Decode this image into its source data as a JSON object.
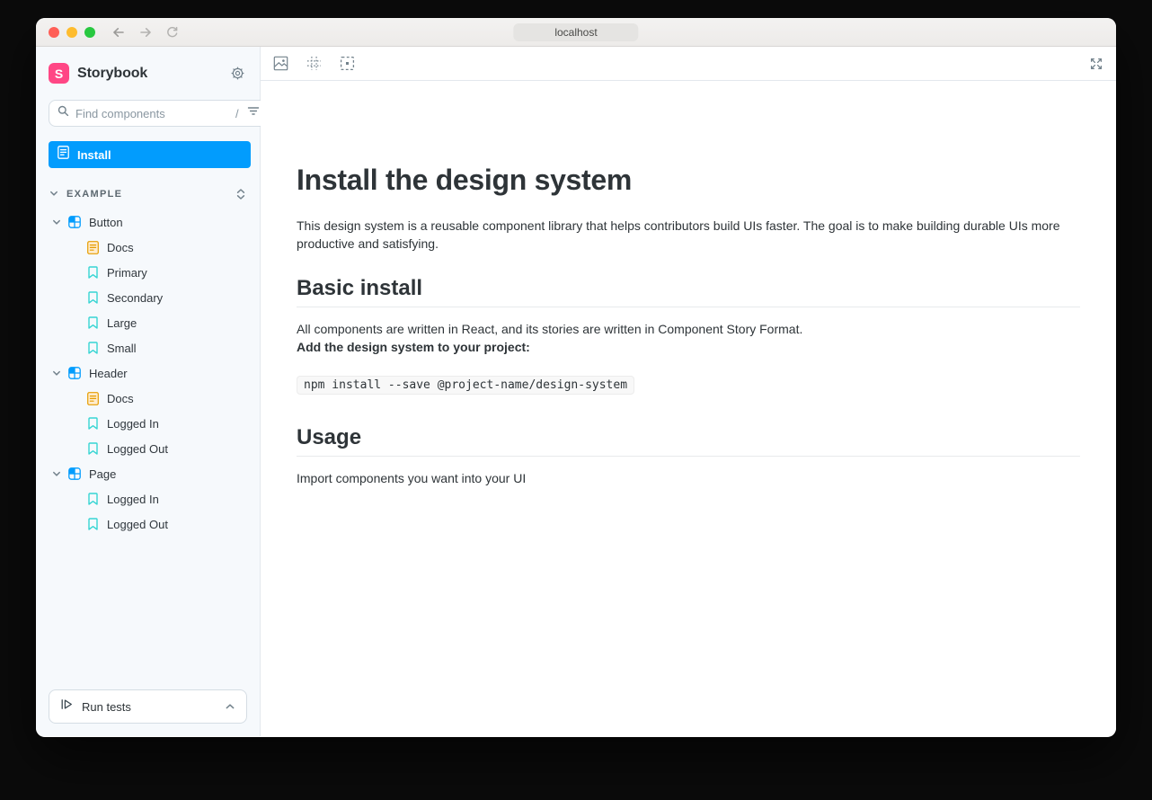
{
  "titlebar": {
    "url": "localhost"
  },
  "sidebar": {
    "brand": "Storybook",
    "logo_letter": "S",
    "search": {
      "placeholder": "Find components",
      "shortcut": "/"
    },
    "selected_doc": {
      "label": "Install"
    },
    "section_label": "EXAMPLE",
    "tree": [
      {
        "label": "Button",
        "type": "component",
        "expanded": true,
        "children": [
          {
            "label": "Docs",
            "type": "docs"
          },
          {
            "label": "Primary",
            "type": "story"
          },
          {
            "label": "Secondary",
            "type": "story"
          },
          {
            "label": "Large",
            "type": "story"
          },
          {
            "label": "Small",
            "type": "story"
          }
        ]
      },
      {
        "label": "Header",
        "type": "component",
        "expanded": true,
        "children": [
          {
            "label": "Docs",
            "type": "docs"
          },
          {
            "label": "Logged In",
            "type": "story"
          },
          {
            "label": "Logged Out",
            "type": "story"
          }
        ]
      },
      {
        "label": "Page",
        "type": "component",
        "expanded": true,
        "children": [
          {
            "label": "Logged In",
            "type": "story"
          },
          {
            "label": "Logged Out",
            "type": "story"
          }
        ]
      }
    ],
    "run_tests_label": "Run tests"
  },
  "content": {
    "title": "Install the design system",
    "intro": "This design system is a reusable component library that helps contributors build UIs faster. The goal is to make building durable UIs more productive and satisfying.",
    "basic_install": {
      "heading": "Basic install",
      "paragraph": "All components are written in React, and its stories are written in Component Story Format.",
      "bold_line": "Add the design system to your project:",
      "code": "npm install --save @project-name/design-system"
    },
    "usage": {
      "heading": "Usage",
      "paragraph": "Import components you want into your UI"
    }
  },
  "colors": {
    "accent_blue": "#029CFD",
    "brand_pink": "#FF4785",
    "story_teal": "#37D5D3",
    "docs_orange": "#E69D00",
    "sidebar_bg": "#F6F9FC",
    "text_dark": "#2E3438",
    "muted_gray": "#73828C"
  }
}
